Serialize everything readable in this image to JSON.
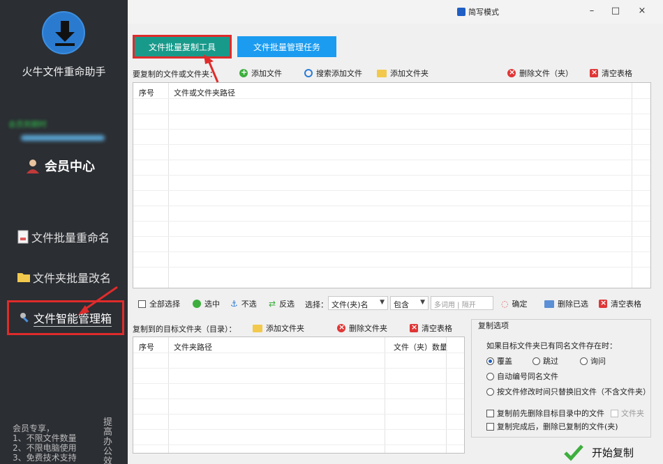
{
  "sidebar": {
    "app_title": "火牛文件重命助手",
    "member_status": "会员到期时",
    "member_center": "会员中心",
    "items": [
      {
        "label": "文件批量重命名"
      },
      {
        "label": "文件夹批量改名"
      },
      {
        "label": "文件智能管理箱"
      }
    ],
    "promo_lines": [
      "会员专享，",
      "1、不限文件数量",
      "2、不限电脑使用",
      "3、免费技术支持"
    ],
    "promo_right": "提高办公效"
  },
  "window": {
    "simple_mode": "简写模式",
    "minimize": "–",
    "maximize": "□",
    "close": "×"
  },
  "tabs": [
    {
      "label": "文件批量复制工具",
      "active": true
    },
    {
      "label": "文件批量管理任务",
      "active": false
    }
  ],
  "source": {
    "label": "要复制的文件或文件夹：",
    "add_file": "添加文件",
    "search_add": "搜索添加文件",
    "add_folder": "添加文件夹",
    "delete": "删除文件（夹）",
    "clear": "清空表格",
    "columns": [
      "序号",
      "文件或文件夹路径"
    ]
  },
  "filter": {
    "select_all": "全部选择",
    "select": "选中",
    "unselect": "不选",
    "invert": "反选",
    "choose_label": "选择：",
    "field": "文件(夹)名",
    "mode": "包含",
    "input_placeholder": "多词用 | 隔开",
    "confirm": "确定",
    "delete_selected": "删除已选",
    "clear": "清空表格"
  },
  "target": {
    "label": "复制到的目标文件夹（目录）：",
    "add_folder": "添加文件夹",
    "delete_folder": "删除文件夹",
    "clear": "清空表格",
    "columns": [
      "序号",
      "文件夹路径",
      "文件（夹）数量"
    ]
  },
  "settings": {
    "title": "复制选项",
    "question": "如果目标文件夹已有同名文件存在时：",
    "overwrite": "覆盖",
    "skip": "跳过",
    "ask": "询问",
    "auto_number": "自动编号同名文件",
    "by_time": "按文件修改时间只替换旧文件（不含文件夹）",
    "delete_before": "复制前先删除目标目录中的文件",
    "folder_opt": "文件夹",
    "delete_after": "复制完成后，删除已复制的文件(夹)",
    "start": "开始复制"
  },
  "colors": {
    "sidebar_bg": "#2b2e33",
    "tab_active": "#189a8b",
    "tab_inactive": "#1b9cf0",
    "annotation": "#e02b2b"
  }
}
